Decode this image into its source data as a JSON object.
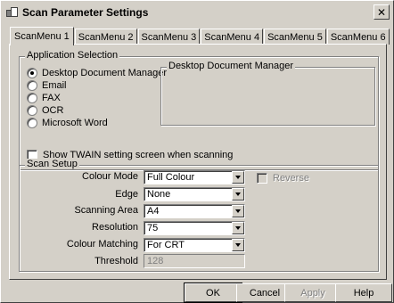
{
  "window": {
    "title": "Scan Parameter Settings",
    "close_glyph": "✕"
  },
  "tabs": [
    "ScanMenu 1",
    "ScanMenu 2",
    "ScanMenu 3",
    "ScanMenu 4",
    "ScanMenu 5",
    "ScanMenu 6"
  ],
  "application_selection": {
    "legend": "Application Selection",
    "options": [
      "Desktop Document Manager",
      "Email",
      "FAX",
      "OCR",
      "Microsoft Word"
    ],
    "selected": "Desktop Document Manager",
    "description_legend": "Desktop Document Manager"
  },
  "show_twain": {
    "label": "Show TWAIN setting screen when scanning",
    "checked": false
  },
  "scan_setup": {
    "legend": "Scan Setup",
    "colour_mode": {
      "label": "Colour Mode",
      "value": "Full Colour"
    },
    "reverse": {
      "label": "Reverse",
      "checked": false,
      "enabled": false
    },
    "edge": {
      "label": "Edge",
      "value": "None"
    },
    "scanning_area": {
      "label": "Scanning Area",
      "value": "A4"
    },
    "resolution": {
      "label": "Resolution",
      "value": "75"
    },
    "colour_matching": {
      "label": "Colour Matching",
      "value": "For CRT"
    },
    "threshold": {
      "label": "Threshold",
      "value": "128"
    }
  },
  "buttons": {
    "ok": "OK",
    "cancel": "Cancel",
    "apply": "Apply",
    "help": "Help"
  }
}
